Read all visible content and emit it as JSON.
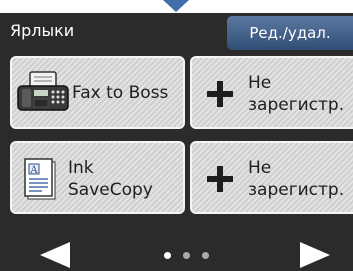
{
  "header": {
    "title": "Ярлыки",
    "edit_button": "Ред./удал."
  },
  "shortcuts": [
    {
      "label": "Fax to Boss",
      "icon": "fax-machine-icon"
    },
    {
      "label_line1": "Не",
      "label_line2": "зарегистр.",
      "icon": "plus-icon"
    },
    {
      "label_line1": "Ink",
      "label_line2": "SaveCopy",
      "icon": "document-icon"
    },
    {
      "label_line1": "Не",
      "label_line2": "зарегистр.",
      "icon": "plus-icon"
    }
  ],
  "pagination": {
    "pages": 3,
    "current_page": 1
  },
  "colors": {
    "screen_background": "#2b2b2b",
    "edit_button": "#3d5c87",
    "tile_background": "#d9d9d9",
    "accent_arrow": "#3f6fa8"
  }
}
